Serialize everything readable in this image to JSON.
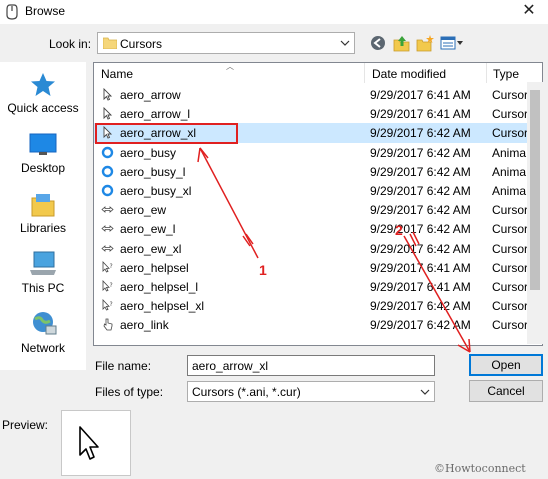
{
  "window": {
    "title": "Browse"
  },
  "lookin": {
    "label": "Look in:",
    "value": "Cursors"
  },
  "toolbar": {
    "back_icon": "back-icon",
    "up_icon": "up-folder-icon",
    "new_folder_icon": "new-folder-icon",
    "view_icon": "view-menu-icon"
  },
  "places": [
    {
      "label": "Quick access",
      "icon": "star-icon"
    },
    {
      "label": "Desktop",
      "icon": "desktop-icon"
    },
    {
      "label": "Libraries",
      "icon": "libraries-icon"
    },
    {
      "label": "This PC",
      "icon": "computer-icon"
    },
    {
      "label": "Network",
      "icon": "network-icon"
    }
  ],
  "columns": [
    "Name",
    "Date modified",
    "Type"
  ],
  "files": [
    {
      "name": "aero_arrow",
      "date": "9/29/2017 6:41 AM",
      "type": "Cursor",
      "icon": "arrow-cursor-icon"
    },
    {
      "name": "aero_arrow_l",
      "date": "9/29/2017 6:41 AM",
      "type": "Cursor",
      "icon": "arrow-cursor-icon"
    },
    {
      "name": "aero_arrow_xl",
      "date": "9/29/2017 6:42 AM",
      "type": "Cursor",
      "icon": "arrow-cursor-icon",
      "selected": true
    },
    {
      "name": "aero_busy",
      "date": "9/29/2017 6:42 AM",
      "type": "Anima",
      "icon": "busy-cursor-icon"
    },
    {
      "name": "aero_busy_l",
      "date": "9/29/2017 6:42 AM",
      "type": "Anima",
      "icon": "busy-cursor-icon"
    },
    {
      "name": "aero_busy_xl",
      "date": "9/29/2017 6:42 AM",
      "type": "Anima",
      "icon": "busy-cursor-icon"
    },
    {
      "name": "aero_ew",
      "date": "9/29/2017 6:42 AM",
      "type": "Cursor",
      "icon": "ew-resize-cursor-icon"
    },
    {
      "name": "aero_ew_l",
      "date": "9/29/2017 6:42 AM",
      "type": "Cursor",
      "icon": "ew-resize-cursor-icon"
    },
    {
      "name": "aero_ew_xl",
      "date": "9/29/2017 6:42 AM",
      "type": "Cursor",
      "icon": "ew-resize-cursor-icon"
    },
    {
      "name": "aero_helpsel",
      "date": "9/29/2017 6:41 AM",
      "type": "Cursor",
      "icon": "help-cursor-icon"
    },
    {
      "name": "aero_helpsel_l",
      "date": "9/29/2017 6:41 AM",
      "type": "Cursor",
      "icon": "help-cursor-icon"
    },
    {
      "name": "aero_helpsel_xl",
      "date": "9/29/2017 6:42 AM",
      "type": "Cursor",
      "icon": "help-cursor-icon"
    },
    {
      "name": "aero_link",
      "date": "9/29/2017 6:42 AM",
      "type": "Cursor",
      "icon": "hand-cursor-icon"
    }
  ],
  "filename": {
    "label": "File name:",
    "value": "aero_arrow_xl"
  },
  "filetype": {
    "label": "Files of type:",
    "value": "Cursors (*.ani, *.cur)"
  },
  "buttons": {
    "open": "Open",
    "cancel": "Cancel"
  },
  "preview": {
    "label": "Preview:"
  },
  "watermark": "©Howtoconnect",
  "annotations": {
    "step1": "1",
    "step2": "2"
  },
  "colors": {
    "selection": "#cce8ff",
    "annotation": "#e02020",
    "accent": "#0078d7"
  }
}
